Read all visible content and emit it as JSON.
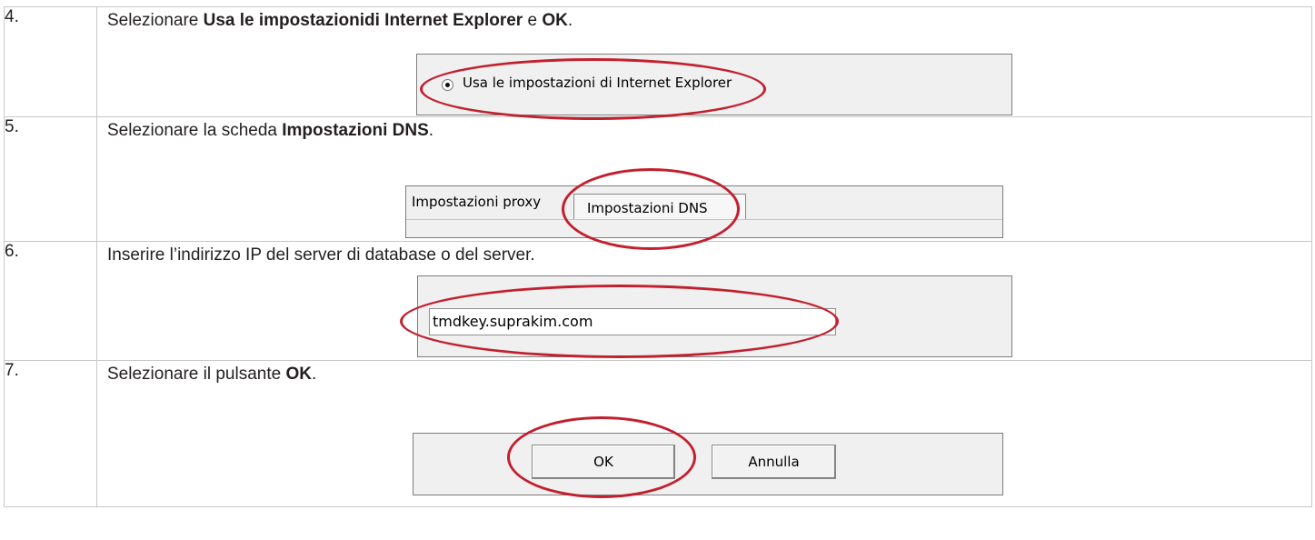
{
  "steps": [
    {
      "number": "4.",
      "instruction": {
        "before": "Selezionare ",
        "bold1": "Usa le impostazionidi Internet Explorer",
        "middle": " e ",
        "bold2": "OK",
        "after": "."
      },
      "screenshot": {
        "radio_label": "Usa le impostazioni di Internet Explorer",
        "radio_checked": true
      }
    },
    {
      "number": "5.",
      "instruction": {
        "before": "Selezionare la scheda ",
        "bold": "Impostazioni DNS",
        "after": "."
      },
      "screenshot": {
        "tabs": [
          "Impostazioni proxy",
          "Impostazioni DNS"
        ],
        "selected_tab": "Impostazioni DNS"
      }
    },
    {
      "number": "6.",
      "instruction": {
        "text": "Inserire l’indirizzo IP del server di database o del server."
      },
      "screenshot": {
        "field_value": "tmdkey.suprakim.com"
      }
    },
    {
      "number": "7.",
      "instruction": {
        "before": "Selezionare il pulsante ",
        "bold": "OK",
        "after": "."
      },
      "screenshot": {
        "buttons": [
          "OK",
          "Annulla"
        ]
      }
    }
  ],
  "highlight_color": "#c2202e"
}
